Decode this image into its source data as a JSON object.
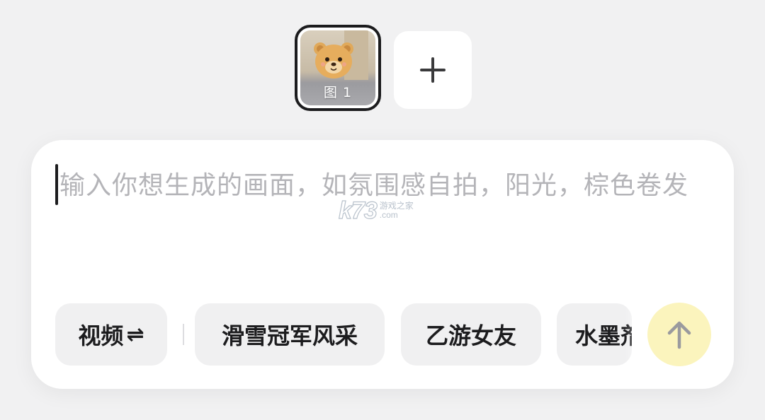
{
  "thumbnails": {
    "selected": {
      "caption": "图 1",
      "icon": "bear-photo"
    },
    "add_icon": "plus-icon"
  },
  "prompt": {
    "placeholder": "输入你想生成的画面，如氛围感自拍，阳光，棕色卷发"
  },
  "chips": {
    "mode": {
      "label": "视频",
      "icon": "⇌"
    },
    "styles": [
      "滑雪冠军风采",
      "乙游女友",
      "水墨剂"
    ]
  },
  "send": {
    "icon": "arrow-up-icon",
    "color": "#fbf4bd"
  },
  "watermark": {
    "main": "k73",
    "line1": "游戏之家",
    "line2": ".com"
  }
}
